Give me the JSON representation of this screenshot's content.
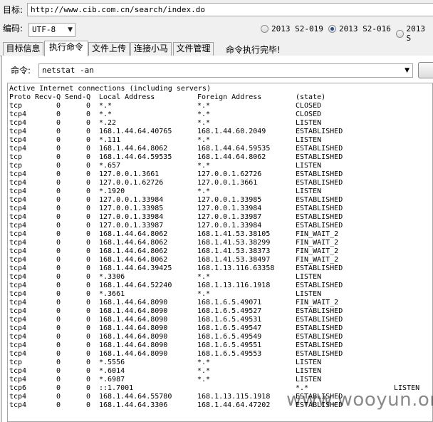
{
  "target": {
    "label": "目标:",
    "url": "http://www.cib.com.cn/search/index.do"
  },
  "encoding": {
    "label": "编码:",
    "value": "UTF-8"
  },
  "versions": [
    {
      "label": "2013 S2-019",
      "selected": false
    },
    {
      "label": "2013 S2-016",
      "selected": true
    },
    {
      "label": "2013 S",
      "selected": false
    }
  ],
  "tabs": [
    {
      "label": "目标信息",
      "active": false
    },
    {
      "label": "执行命令",
      "active": true
    },
    {
      "label": "文件上传",
      "active": false
    },
    {
      "label": "连接小马",
      "active": false
    },
    {
      "label": "文件管理",
      "active": false
    }
  ],
  "status_text": "命令执行完毕!",
  "command": {
    "label": "命令:",
    "value": "netstat -an"
  },
  "output": {
    "heading": "Active Internet connections (including servers)",
    "columns": [
      "Proto",
      "Recv-Q",
      "Send-Q",
      "Local Address",
      "Foreign Address",
      "(state)"
    ],
    "rows": [
      [
        "tcp",
        "0",
        "0",
        "*.*",
        "*.*",
        "CLOSED",
        ""
      ],
      [
        "tcp4",
        "0",
        "0",
        "*.*",
        "*.*",
        "CLOSED",
        ""
      ],
      [
        "tcp4",
        "0",
        "0",
        "*.22",
        "*.*",
        "LISTEN",
        ""
      ],
      [
        "tcp4",
        "0",
        "0",
        "168.1.44.64.40765",
        "168.1.44.60.2049",
        "ESTABLISHED",
        ""
      ],
      [
        "tcp4",
        "0",
        "0",
        "*.111",
        "*.*",
        "LISTEN",
        ""
      ],
      [
        "tcp4",
        "0",
        "0",
        "168.1.44.64.8062",
        "168.1.44.64.59535",
        "ESTABLISHED",
        ""
      ],
      [
        "tcp",
        "0",
        "0",
        "168.1.44.64.59535",
        "168.1.44.64.8062",
        "ESTABLISHED",
        ""
      ],
      [
        "tcp",
        "0",
        "0",
        "*.657",
        "*.*",
        "LISTEN",
        ""
      ],
      [
        "tcp4",
        "0",
        "0",
        "127.0.0.1.3661",
        "127.0.0.1.62726",
        "ESTABLISHED",
        ""
      ],
      [
        "tcp4",
        "0",
        "0",
        "127.0.0.1.62726",
        "127.0.0.1.3661",
        "ESTABLISHED",
        ""
      ],
      [
        "tcp4",
        "0",
        "0",
        "*.1920",
        "*.*",
        "LISTEN",
        ""
      ],
      [
        "tcp4",
        "0",
        "0",
        "127.0.0.1.33984",
        "127.0.0.1.33985",
        "ESTABLISHED",
        ""
      ],
      [
        "tcp4",
        "0",
        "0",
        "127.0.0.1.33985",
        "127.0.0.1.33984",
        "ESTABLISHED",
        ""
      ],
      [
        "tcp4",
        "0",
        "0",
        "127.0.0.1.33984",
        "127.0.0.1.33987",
        "ESTABLISHED",
        ""
      ],
      [
        "tcp4",
        "0",
        "0",
        "127.0.0.1.33987",
        "127.0.0.1.33984",
        "ESTABLISHED",
        ""
      ],
      [
        "tcp4",
        "0",
        "0",
        "168.1.44.64.8062",
        "168.1.41.53.38105",
        "FIN_WAIT_2",
        ""
      ],
      [
        "tcp4",
        "0",
        "0",
        "168.1.44.64.8062",
        "168.1.41.53.38299",
        "FIN_WAIT_2",
        ""
      ],
      [
        "tcp4",
        "0",
        "0",
        "168.1.44.64.8062",
        "168.1.41.53.38373",
        "FIN_WAIT_2",
        ""
      ],
      [
        "tcp4",
        "0",
        "0",
        "168.1.44.64.8062",
        "168.1.41.53.38497",
        "FIN_WAIT_2",
        ""
      ],
      [
        "tcp4",
        "0",
        "0",
        "168.1.44.64.39425",
        "168.1.13.116.63358",
        "ESTABLISHED",
        ""
      ],
      [
        "tcp4",
        "0",
        "0",
        "*.3306",
        "*.*",
        "LISTEN",
        ""
      ],
      [
        "tcp4",
        "0",
        "0",
        "168.1.44.64.52240",
        "168.1.13.116.1918",
        "ESTABLISHED",
        ""
      ],
      [
        "tcp4",
        "0",
        "0",
        "*.3661",
        "*.*",
        "LISTEN",
        ""
      ],
      [
        "tcp4",
        "0",
        "0",
        "168.1.44.64.8090",
        "168.1.6.5.49071",
        "FIN_WAIT_2",
        ""
      ],
      [
        "tcp4",
        "0",
        "0",
        "168.1.44.64.8090",
        "168.1.6.5.49527",
        "ESTABLISHED",
        ""
      ],
      [
        "tcp4",
        "0",
        "0",
        "168.1.44.64.8090",
        "168.1.6.5.49531",
        "ESTABLISHED",
        ""
      ],
      [
        "tcp4",
        "0",
        "0",
        "168.1.44.64.8090",
        "168.1.6.5.49547",
        "ESTABLISHED",
        ""
      ],
      [
        "tcp4",
        "0",
        "0",
        "168.1.44.64.8090",
        "168.1.6.5.49549",
        "ESTABLISHED",
        ""
      ],
      [
        "tcp4",
        "0",
        "0",
        "168.1.44.64.8090",
        "168.1.6.5.49551",
        "ESTABLISHED",
        ""
      ],
      [
        "tcp4",
        "0",
        "0",
        "168.1.44.64.8090",
        "168.1.6.5.49553",
        "ESTABLISHED",
        ""
      ],
      [
        "tcp",
        "0",
        "0",
        "*.5556",
        "*.*",
        "LISTEN",
        ""
      ],
      [
        "tcp4",
        "0",
        "0",
        "*.6014",
        "*.*",
        "LISTEN",
        ""
      ],
      [
        "tcp4",
        "0",
        "0",
        "*.6987",
        "*.*",
        "LISTEN",
        ""
      ],
      [
        "tcp6",
        "0",
        "0",
        "::1.7001",
        "",
        "*.*",
        "LISTEN"
      ],
      [
        "tcp4",
        "0",
        "0",
        "168.1.44.64.55780",
        "168.1.13.115.1918",
        "ESTABLISHED",
        ""
      ],
      [
        "tcp4",
        "0",
        "0",
        "168.1.44.64.3306",
        "168.1.44.64.47202",
        "ESTABLISHED",
        ""
      ]
    ]
  },
  "watermark": "www.wooyun.org",
  "icons": {
    "dropdown": "chevron-down-icon"
  }
}
